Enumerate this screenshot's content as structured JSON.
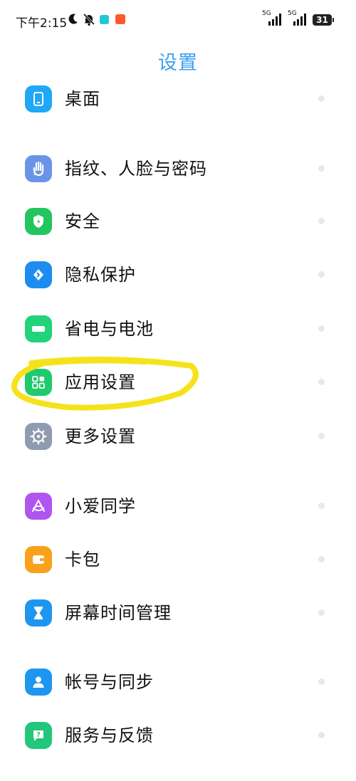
{
  "status_bar": {
    "time": "下午2:15",
    "battery": "31",
    "signal_1_label": "5G",
    "signal_2_label": "5G"
  },
  "page": {
    "title": "设置"
  },
  "menu": {
    "items": [
      {
        "label": "桌面",
        "icon": "desktop-icon",
        "color": "#1fa8f5"
      },
      {
        "label": "指纹、人脸与密码",
        "icon": "hand-icon",
        "color": "#6b94e8"
      },
      {
        "label": "安全",
        "icon": "shield-icon",
        "color": "#22c55e"
      },
      {
        "label": "隐私保护",
        "icon": "privacy-icon",
        "color": "#1d8cf0"
      },
      {
        "label": "省电与电池",
        "icon": "battery-icon",
        "color": "#22d37a"
      },
      {
        "label": "应用设置",
        "icon": "apps-grid-icon",
        "color": "#1ecb6c"
      },
      {
        "label": "更多设置",
        "icon": "gear-icon",
        "color": "#8f9bb0"
      },
      {
        "label": "小爱同学",
        "icon": "xiaoai-icon",
        "color": "#b055f0"
      },
      {
        "label": "卡包",
        "icon": "wallet-icon",
        "color": "#f7a21a"
      },
      {
        "label": "屏幕时间管理",
        "icon": "hourglass-icon",
        "color": "#1e96f0"
      },
      {
        "label": "帐号与同步",
        "icon": "person-icon",
        "color": "#1e96f0"
      },
      {
        "label": "服务与反馈",
        "icon": "help-icon",
        "color": "#22c77a"
      }
    ]
  },
  "annotation": {
    "highlight_color": "#f5e21a"
  }
}
